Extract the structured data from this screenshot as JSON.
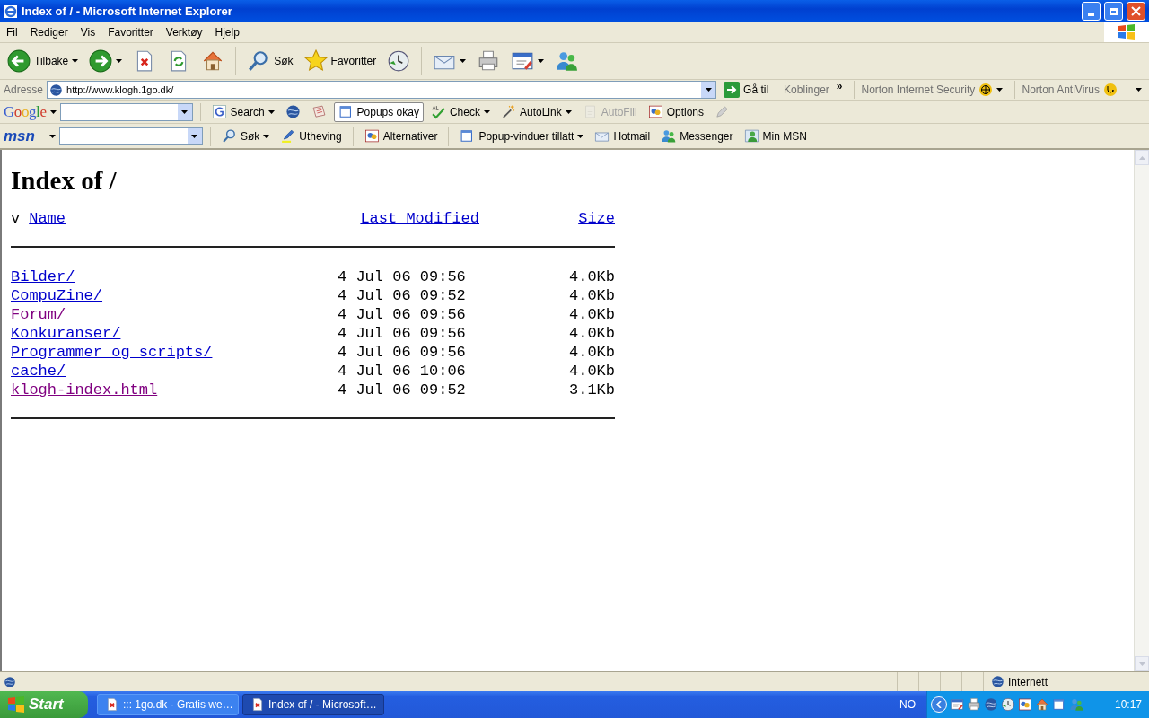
{
  "window": {
    "title": "Index of / - Microsoft Internet Explorer"
  },
  "menu": [
    "Fil",
    "Rediger",
    "Vis",
    "Favoritter",
    "Verktøy",
    "Hjelp"
  ],
  "toolbar": [
    {
      "kind": "back",
      "label": "Tilbake",
      "dropdown": true
    },
    {
      "kind": "forward",
      "dropdown": true
    },
    {
      "kind": "stop",
      "dropdown": false
    },
    {
      "kind": "refresh",
      "dropdown": false
    },
    {
      "kind": "home",
      "dropdown": false
    },
    {
      "kind": "separator"
    },
    {
      "kind": "search",
      "label": "Søk",
      "dropdown": false
    },
    {
      "kind": "favorites",
      "label": "Favoritter",
      "dropdown": false
    },
    {
      "kind": "history",
      "dropdown": false
    },
    {
      "kind": "separator"
    },
    {
      "kind": "mail",
      "dropdown": true
    },
    {
      "kind": "print",
      "dropdown": false
    },
    {
      "kind": "edit",
      "dropdown": true
    },
    {
      "kind": "messenger",
      "dropdown": false
    }
  ],
  "address": {
    "label": "Adresse",
    "value": "http://www.klogh.1go.dk/",
    "go": "Gå til",
    "links": "Koblinger",
    "more": "»",
    "norton_security": "Norton Internet Security",
    "norton_antivirus": "Norton AntiVirus"
  },
  "google_bar": {
    "logo": "Google",
    "items": [
      {
        "kind": "gsearch",
        "label": "Search",
        "dropdown": true,
        "disabled": false
      },
      {
        "kind": "globe",
        "dropdown": false,
        "disabled": false
      },
      {
        "kind": "news",
        "dropdown": false,
        "disabled": false
      },
      {
        "kind": "popup",
        "label": "Popups okay",
        "dropdown": false,
        "disabled": false
      },
      {
        "kind": "check",
        "label": "Check",
        "dropdown": true,
        "disabled": false
      },
      {
        "kind": "autolink",
        "label": "AutoLink",
        "dropdown": true,
        "disabled": false
      },
      {
        "kind": "autofill",
        "label": "AutoFill",
        "dropdown": false,
        "disabled": true
      },
      {
        "kind": "options",
        "label": "Options",
        "dropdown": false,
        "disabled": false
      },
      {
        "kind": "pencil",
        "dropdown": false,
        "disabled": false
      }
    ]
  },
  "msn_bar": {
    "logo": "msn",
    "items": [
      {
        "kind": "search",
        "label": "Søk",
        "dropdown": true
      },
      {
        "kind": "highlight",
        "label": "Utheving",
        "dropdown": false
      },
      {
        "kind": "options",
        "label": "Alternativer",
        "dropdown": false
      },
      {
        "kind": "popup",
        "label": "Popup-vinduer tillatt",
        "dropdown": true
      },
      {
        "kind": "mail",
        "label": "Hotmail",
        "dropdown": false
      },
      {
        "kind": "messenger",
        "label": "Messenger",
        "dropdown": false
      },
      {
        "kind": "person",
        "label": "Min MSN",
        "dropdown": false
      }
    ]
  },
  "page": {
    "heading": "Index of /",
    "sort_mark": "v",
    "columns": [
      "Name",
      "Last Modified",
      "Size"
    ],
    "rows": [
      {
        "name": "Bilder/",
        "modified": "4 Jul 06 09:56",
        "size": "4.0Kb",
        "visited": false
      },
      {
        "name": "CompuZine/",
        "modified": "4 Jul 06 09:52",
        "size": "4.0Kb",
        "visited": false
      },
      {
        "name": "Forum/",
        "modified": "4 Jul 06 09:56",
        "size": "4.0Kb",
        "visited": true
      },
      {
        "name": "Konkuranser/",
        "modified": "4 Jul 06 09:56",
        "size": "4.0Kb",
        "visited": false
      },
      {
        "name": "Programmer og scripts/",
        "modified": "4 Jul 06 09:56",
        "size": "4.0Kb",
        "visited": false
      },
      {
        "name": "cache/",
        "modified": "4 Jul 06 10:06",
        "size": "4.0Kb",
        "visited": false
      },
      {
        "name": "klogh-index.html",
        "modified": "4 Jul 06 09:52",
        "size": "3.1Kb",
        "visited": true
      }
    ]
  },
  "status_bar": {
    "zone": "Internett"
  },
  "taskbar": {
    "start": "Start",
    "tasks": [
      {
        "label": "::: 1go.dk - Gratis we…",
        "selected": false
      },
      {
        "label": "Index of / - Microsoft…",
        "selected": true
      }
    ],
    "language": "NO",
    "clock": "10:17"
  }
}
